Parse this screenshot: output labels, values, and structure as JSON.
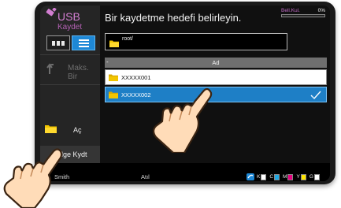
{
  "sidebar": {
    "app_title": "USB",
    "app_subtitle": "Kaydet",
    "max_label": "Maks. Bir",
    "open_label": "Aç",
    "save_label": "Blge Kydt"
  },
  "main": {
    "prompt": "Bir kaydetme hedefi belirleyin.",
    "capacity_label": "Bell.Kul.",
    "capacity_value": "0%",
    "capacity_fraction": 0.0,
    "path": "root/",
    "sort_marker": "-",
    "column_name": "Ad",
    "files": [
      {
        "name": "XXXXX001",
        "selected": false
      },
      {
        "name": "XXXXX002",
        "selected": true
      }
    ]
  },
  "status": {
    "user": "Smith",
    "job_status": "Atıl",
    "toner": [
      {
        "label": "K",
        "color": "#ffffff"
      },
      {
        "label": "C",
        "color": "#1ea7e1"
      },
      {
        "label": "M",
        "color": "#e6007e"
      },
      {
        "label": "Y",
        "color": "#ffe600"
      },
      {
        "label": "G",
        "color": "#ffffff"
      }
    ]
  },
  "colors": {
    "accent_blue": "#1e7fc6",
    "usb_purple": "#d27ed1",
    "folder_yellow": "#f2c500"
  },
  "icons": {
    "usb": "usb-icon",
    "view_grid": "grid-view-icon",
    "view_list": "list-view-icon",
    "max": "up-arrow-icon",
    "open": "folder-icon",
    "selected": "checkmark-icon",
    "toner": "toner-icon"
  }
}
